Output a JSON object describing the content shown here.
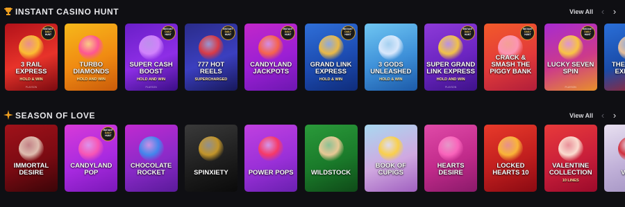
{
  "sections": [
    {
      "title": "Instant Casino Hunt",
      "icon": "trophy-icon",
      "view_all": "View All",
      "prev_icon": "chevron-left-icon",
      "next_icon": "chevron-right-icon",
      "tiles": [
        {
          "title": "3 Rail Express",
          "sub": "Hold & Win",
          "provider": "Playson",
          "badge": true,
          "colors": [
            "#b3121a",
            "#e8332a",
            "#7a0a10"
          ],
          "art": "#ffcc33"
        },
        {
          "title": "Turbo Diamonds",
          "sub": "Hold and Win",
          "provider": "",
          "badge": false,
          "colors": [
            "#f6b81a",
            "#f08a12",
            "#c95b0a"
          ],
          "art": "#ff4fa0"
        },
        {
          "title": "Super Cash Boost",
          "sub": "Hold and Win",
          "provider": "Playson",
          "badge": true,
          "colors": [
            "#6a1fc8",
            "#8e2ee6",
            "#3a0e86"
          ],
          "art": "#d98cff"
        },
        {
          "title": "777 Hot Reels",
          "sub": "Supercharged",
          "provider": "",
          "badge": true,
          "colors": [
            "#2a2c8a",
            "#3b3fbf",
            "#17185a"
          ],
          "art": "#e93a3a"
        },
        {
          "title": "Candyland Jackpots",
          "sub": "",
          "provider": "",
          "badge": true,
          "colors": [
            "#c227c9",
            "#9a1fd4",
            "#6d17b0"
          ],
          "art": "#ff6a3d"
        },
        {
          "title": "Grand Link Express",
          "sub": "Hold & Win",
          "provider": "",
          "badge": true,
          "colors": [
            "#2f6fd8",
            "#1c4bb0",
            "#0f2c7a"
          ],
          "art": "#ffc43a"
        },
        {
          "title": "3 Gods Unleashed",
          "sub": "Hold & Win",
          "provider": "",
          "badge": false,
          "colors": [
            "#6fc6f2",
            "#3d8fd8",
            "#1c5aa8"
          ],
          "art": "#e8f0ff"
        },
        {
          "title": "Super Grand Link Express",
          "sub": "Hold and Win",
          "provider": "Playson",
          "badge": true,
          "colors": [
            "#8d3ad8",
            "#6a24c0",
            "#3d1288"
          ],
          "art": "#ffd23a"
        },
        {
          "title": "Crack & Smash the Piggy Bank",
          "sub": "",
          "provider": "",
          "badge": true,
          "colors": [
            "#f25a2a",
            "#e23a3a",
            "#b01e3a"
          ],
          "art": "#ff9ec0"
        },
        {
          "title": "Lucky Seven Spin",
          "sub": "",
          "provider": "Playson",
          "badge": true,
          "colors": [
            "#a82bd0",
            "#cc3a8a",
            "#e8902a"
          ],
          "art": "#ffd23a"
        },
        {
          "title": "The Great Express",
          "sub": "",
          "provider": "",
          "badge": false,
          "colors": [
            "#2a6fd8",
            "#1a4ba8",
            "#b01e1e"
          ],
          "art": "#ffcc99"
        }
      ]
    },
    {
      "title": "Season of Love",
      "icon": "sparkle-icon",
      "view_all": "View All",
      "prev_icon": "chevron-left-icon",
      "next_icon": "chevron-right-icon",
      "tiles": [
        {
          "title": "Immortal Desire",
          "sub": "",
          "provider": "",
          "badge": false,
          "colors": [
            "#a0121a",
            "#7a0a12",
            "#3a0508"
          ],
          "art": "#e8d0c0"
        },
        {
          "title": "Candyland Pop",
          "sub": "",
          "provider": "",
          "badge": true,
          "colors": [
            "#d83ad8",
            "#a82ae0",
            "#7a18b8"
          ],
          "art": "#ff5ab0"
        },
        {
          "title": "Chocolate Rocket",
          "sub": "",
          "provider": "",
          "badge": false,
          "colors": [
            "#c02ad0",
            "#8a2ac8",
            "#5a1a9a"
          ],
          "art": "#3a8ff0"
        },
        {
          "title": "Spinxiety",
          "sub": "",
          "provider": "",
          "badge": false,
          "colors": [
            "#3a3a3a",
            "#1e1e1e",
            "#0a0a0a"
          ],
          "art": "#d4a12a"
        },
        {
          "title": "Power Pops",
          "sub": "",
          "provider": "",
          "badge": false,
          "colors": [
            "#c040e0",
            "#9a30d8",
            "#6a20b0"
          ],
          "art": "#ff3a5a"
        },
        {
          "title": "Wildstock",
          "sub": "",
          "provider": "",
          "badge": false,
          "colors": [
            "#2a9a3a",
            "#1a7a2a",
            "#0f4a18"
          ],
          "art": "#ffd0a0"
        },
        {
          "title": "Book of Cupigs",
          "sub": "",
          "provider": "",
          "badge": false,
          "colors": [
            "#a8d8f0",
            "#d0a8e0",
            "#a060c0"
          ],
          "art": "#ffd23a"
        },
        {
          "title": "Hearts Desire",
          "sub": "",
          "provider": "",
          "badge": false,
          "colors": [
            "#e04aa8",
            "#c02a8a",
            "#8a1a6a"
          ],
          "art": "#ff6ac0"
        },
        {
          "title": "Locked Hearts 10",
          "sub": "",
          "provider": "",
          "badge": false,
          "colors": [
            "#e83a2a",
            "#c01e1e",
            "#8a0a12"
          ],
          "art": "#ffc43a"
        },
        {
          "title": "Valentine Collection",
          "sub": "10 Lines",
          "provider": "",
          "badge": false,
          "colors": [
            "#e83a3a",
            "#c81e3a",
            "#9a0a2a"
          ],
          "art": "#fff0e0"
        },
        {
          "title": "Val C",
          "sub": "",
          "provider": "",
          "badge": false,
          "colors": [
            "#e8e0f0",
            "#c0b0d8",
            "#a090c0"
          ],
          "art": "#d01e2a"
        }
      ]
    }
  ],
  "badge_text": [
    "Instant",
    "Daily",
    "Hunt"
  ]
}
